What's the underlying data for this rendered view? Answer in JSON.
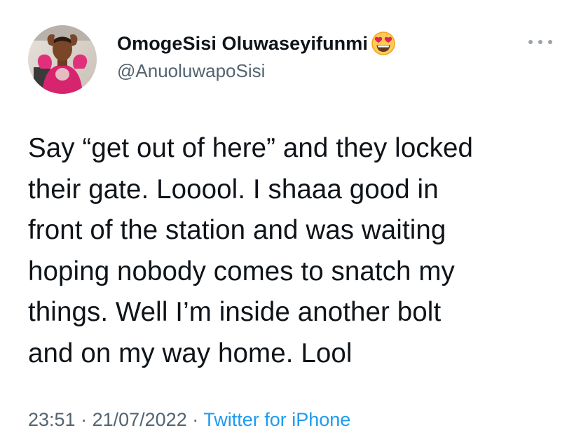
{
  "tweet": {
    "display_name": "OmogeSisi Oluwaseyifunmi",
    "name_emoji": "heart-eyes-emoji",
    "handle": "@AnuoluwapoSisi",
    "text": "Say “get out of here” and they locked\ntheir gate. Looool. I shaaa good in\nfront of the station and was waiting\nhoping nobody comes to snatch my\nthings. Well I’m inside another bolt\nand on my way home. Lool",
    "time": "23:51",
    "separator": " · ",
    "date": "21/07/2022",
    "source": "Twitter for iPhone"
  },
  "icons": {
    "avatar": "profile-photo",
    "more": "more-options-icon"
  },
  "colors": {
    "text": "#0f1419",
    "secondary": "#536471",
    "link": "#1d9bf0",
    "avatar_dress": "#d6246e"
  }
}
